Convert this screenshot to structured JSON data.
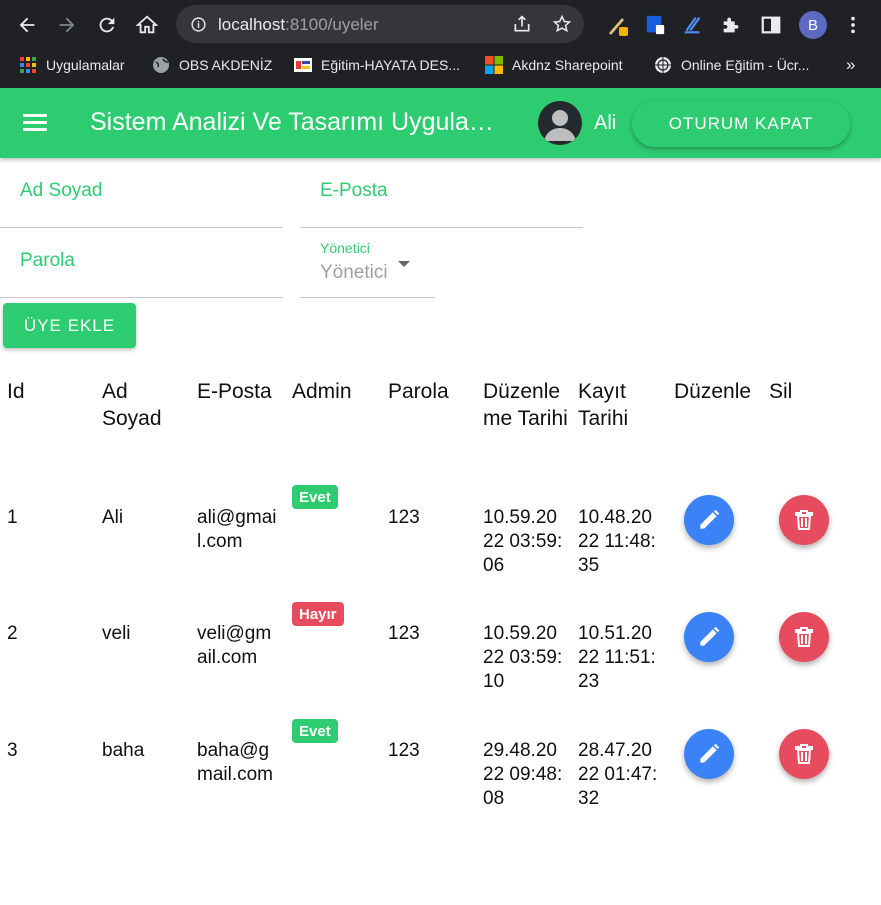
{
  "browser": {
    "url_host": "localhost",
    "url_path": ":8100/uyeler",
    "profile_initial": "B",
    "bookmarks": [
      {
        "label": "Uygulamalar",
        "icon": "apps-grid-icon"
      },
      {
        "label": "OBS AKDENİZ",
        "icon": "globe-icon"
      },
      {
        "label": "Eğitim-HAYATA DES...",
        "icon": "bookmark-favicon-icon"
      },
      {
        "label": "Akdnz Sharepoint",
        "icon": "microsoft-icon"
      },
      {
        "label": "Online Eğitim - Ücr...",
        "icon": "globe-icon"
      }
    ],
    "more_bookmarks": "»"
  },
  "appbar": {
    "title": "Sistem Analizi Ve Tasarımı Uygulaması",
    "user_name": "Ali",
    "logout_label": "OTURUM KAPAT",
    "color": "#2ecc71"
  },
  "form": {
    "name_placeholder": "Ad Soyad",
    "email_placeholder": "E-Posta",
    "password_placeholder": "Parola",
    "role_label": "Yönetici",
    "role_value": "Yönetici",
    "add_button": "ÜYE EKLE"
  },
  "table": {
    "headers": {
      "id": "Id",
      "name": "Ad Soyad",
      "email": "E-Posta",
      "admin": "Admin",
      "password": "Parola",
      "updated": "Düzenleme Tarihi",
      "created": "Kayıt Tarihi",
      "edit": "Düzenle",
      "delete": "Sil"
    },
    "rows": [
      {
        "id": "1",
        "name": "Ali",
        "email": "ali@gmail.com",
        "admin": "Evet",
        "admin_color": "#2ecc71",
        "password": "123",
        "updated": "10.59.2022 03:59:06",
        "created": "10.48.2022 11:48:35"
      },
      {
        "id": "2",
        "name": "veli",
        "email": "veli@gmail.com",
        "admin": "Hayır",
        "admin_color": "#e74c5e",
        "password": "123",
        "updated": "10.59.2022 03:59:10",
        "created": "10.51.2022 11:51:23"
      },
      {
        "id": "3",
        "name": "baha",
        "email": "baha@gmail.com",
        "admin": "Evet",
        "admin_color": "#2ecc71",
        "password": "123",
        "updated": "29.48.2022 09:48:08",
        "created": "28.47.2022 01:47:32"
      }
    ]
  }
}
